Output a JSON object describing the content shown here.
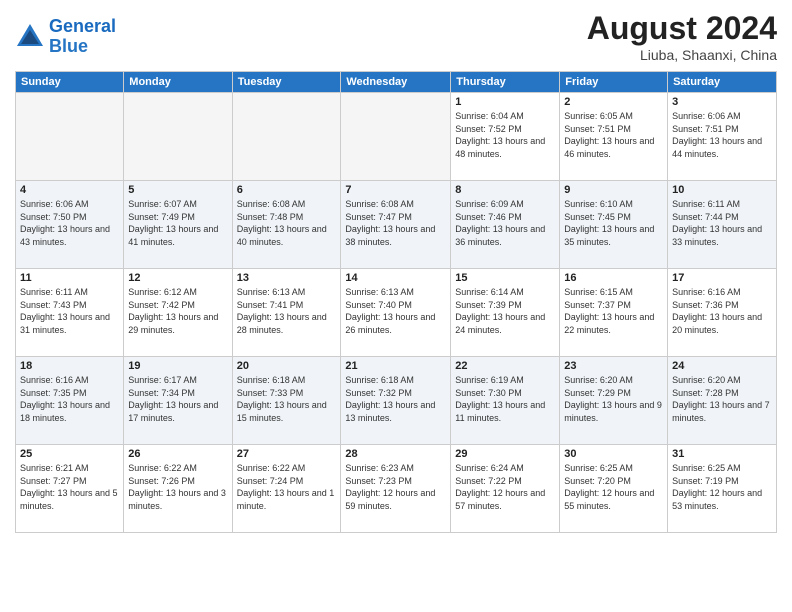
{
  "header": {
    "logo_line1": "General",
    "logo_line2": "Blue",
    "month_year": "August 2024",
    "location": "Liuba, Shaanxi, China"
  },
  "weekdays": [
    "Sunday",
    "Monday",
    "Tuesday",
    "Wednesday",
    "Thursday",
    "Friday",
    "Saturday"
  ],
  "weeks": [
    [
      {
        "day": "",
        "empty": true
      },
      {
        "day": "",
        "empty": true
      },
      {
        "day": "",
        "empty": true
      },
      {
        "day": "",
        "empty": true
      },
      {
        "day": "1",
        "sunrise": "6:04 AM",
        "sunset": "7:52 PM",
        "daylight": "13 hours and 48 minutes."
      },
      {
        "day": "2",
        "sunrise": "6:05 AM",
        "sunset": "7:51 PM",
        "daylight": "13 hours and 46 minutes."
      },
      {
        "day": "3",
        "sunrise": "6:06 AM",
        "sunset": "7:51 PM",
        "daylight": "13 hours and 44 minutes."
      }
    ],
    [
      {
        "day": "4",
        "sunrise": "6:06 AM",
        "sunset": "7:50 PM",
        "daylight": "13 hours and 43 minutes."
      },
      {
        "day": "5",
        "sunrise": "6:07 AM",
        "sunset": "7:49 PM",
        "daylight": "13 hours and 41 minutes."
      },
      {
        "day": "6",
        "sunrise": "6:08 AM",
        "sunset": "7:48 PM",
        "daylight": "13 hours and 40 minutes."
      },
      {
        "day": "7",
        "sunrise": "6:08 AM",
        "sunset": "7:47 PM",
        "daylight": "13 hours and 38 minutes."
      },
      {
        "day": "8",
        "sunrise": "6:09 AM",
        "sunset": "7:46 PM",
        "daylight": "13 hours and 36 minutes."
      },
      {
        "day": "9",
        "sunrise": "6:10 AM",
        "sunset": "7:45 PM",
        "daylight": "13 hours and 35 minutes."
      },
      {
        "day": "10",
        "sunrise": "6:11 AM",
        "sunset": "7:44 PM",
        "daylight": "13 hours and 33 minutes."
      }
    ],
    [
      {
        "day": "11",
        "sunrise": "6:11 AM",
        "sunset": "7:43 PM",
        "daylight": "13 hours and 31 minutes."
      },
      {
        "day": "12",
        "sunrise": "6:12 AM",
        "sunset": "7:42 PM",
        "daylight": "13 hours and 29 minutes."
      },
      {
        "day": "13",
        "sunrise": "6:13 AM",
        "sunset": "7:41 PM",
        "daylight": "13 hours and 28 minutes."
      },
      {
        "day": "14",
        "sunrise": "6:13 AM",
        "sunset": "7:40 PM",
        "daylight": "13 hours and 26 minutes."
      },
      {
        "day": "15",
        "sunrise": "6:14 AM",
        "sunset": "7:39 PM",
        "daylight": "13 hours and 24 minutes."
      },
      {
        "day": "16",
        "sunrise": "6:15 AM",
        "sunset": "7:37 PM",
        "daylight": "13 hours and 22 minutes."
      },
      {
        "day": "17",
        "sunrise": "6:16 AM",
        "sunset": "7:36 PM",
        "daylight": "13 hours and 20 minutes."
      }
    ],
    [
      {
        "day": "18",
        "sunrise": "6:16 AM",
        "sunset": "7:35 PM",
        "daylight": "13 hours and 18 minutes."
      },
      {
        "day": "19",
        "sunrise": "6:17 AM",
        "sunset": "7:34 PM",
        "daylight": "13 hours and 17 minutes."
      },
      {
        "day": "20",
        "sunrise": "6:18 AM",
        "sunset": "7:33 PM",
        "daylight": "13 hours and 15 minutes."
      },
      {
        "day": "21",
        "sunrise": "6:18 AM",
        "sunset": "7:32 PM",
        "daylight": "13 hours and 13 minutes."
      },
      {
        "day": "22",
        "sunrise": "6:19 AM",
        "sunset": "7:30 PM",
        "daylight": "13 hours and 11 minutes."
      },
      {
        "day": "23",
        "sunrise": "6:20 AM",
        "sunset": "7:29 PM",
        "daylight": "13 hours and 9 minutes."
      },
      {
        "day": "24",
        "sunrise": "6:20 AM",
        "sunset": "7:28 PM",
        "daylight": "13 hours and 7 minutes."
      }
    ],
    [
      {
        "day": "25",
        "sunrise": "6:21 AM",
        "sunset": "7:27 PM",
        "daylight": "13 hours and 5 minutes."
      },
      {
        "day": "26",
        "sunrise": "6:22 AM",
        "sunset": "7:26 PM",
        "daylight": "13 hours and 3 minutes."
      },
      {
        "day": "27",
        "sunrise": "6:22 AM",
        "sunset": "7:24 PM",
        "daylight": "13 hours and 1 minute."
      },
      {
        "day": "28",
        "sunrise": "6:23 AM",
        "sunset": "7:23 PM",
        "daylight": "12 hours and 59 minutes."
      },
      {
        "day": "29",
        "sunrise": "6:24 AM",
        "sunset": "7:22 PM",
        "daylight": "12 hours and 57 minutes."
      },
      {
        "day": "30",
        "sunrise": "6:25 AM",
        "sunset": "7:20 PM",
        "daylight": "12 hours and 55 minutes."
      },
      {
        "day": "31",
        "sunrise": "6:25 AM",
        "sunset": "7:19 PM",
        "daylight": "12 hours and 53 minutes."
      }
    ]
  ]
}
